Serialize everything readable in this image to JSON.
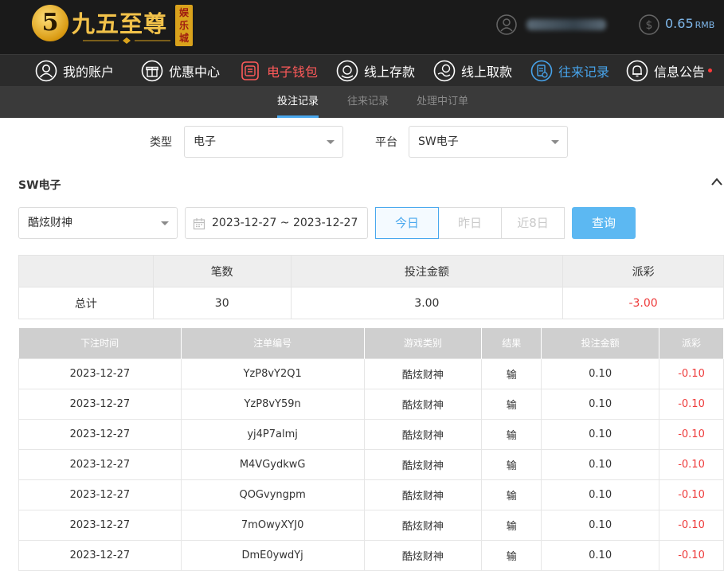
{
  "header": {
    "logo_char": "5",
    "logo_text": "九五至尊",
    "logo_seal": "娱乐城",
    "balance_value": "0.65",
    "balance_unit": "RMB"
  },
  "nav": {
    "items": [
      {
        "label": "我的账户",
        "icon": "user-icon"
      },
      {
        "label": "优惠中心",
        "icon": "gift-icon"
      },
      {
        "label": "电子钱包",
        "icon": "wallet-icon"
      },
      {
        "label": "线上存款",
        "icon": "deposit-icon"
      },
      {
        "label": "线上取款",
        "icon": "withdraw-icon"
      },
      {
        "label": "往来记录",
        "icon": "records-icon"
      },
      {
        "label": "信息公告",
        "icon": "bell-icon"
      }
    ],
    "active_color": "#47a3ea",
    "highlight_color": "#ff5a5a"
  },
  "subnav": {
    "items": [
      "投注记录",
      "往来记录",
      "处理中订单"
    ]
  },
  "filters": {
    "type_label": "类型",
    "type_value": "电子",
    "platform_label": "平台",
    "platform_value": "SW电子"
  },
  "section": {
    "title": "SW电子",
    "game_value": "酷炫财神",
    "date_range": "2023-12-27 ~ 2023-12-27",
    "day_buttons": [
      "今日",
      "昨日",
      "近8日"
    ],
    "query_label": "查询"
  },
  "summary": {
    "headers": [
      "",
      "笔数",
      "投注金额",
      "派彩"
    ],
    "total_label": "总计",
    "count": "30",
    "bet_amount": "3.00",
    "payout": "-3.00"
  },
  "records": {
    "headers": [
      "下注时间",
      "注单编号",
      "游戏类别",
      "结果",
      "投注金额",
      "派彩"
    ],
    "rows": [
      [
        "2023-12-27",
        "YzP8vY2Q1",
        "酷炫财神",
        "输",
        "0.10",
        "-0.10"
      ],
      [
        "2023-12-27",
        "YzP8vY59n",
        "酷炫财神",
        "输",
        "0.10",
        "-0.10"
      ],
      [
        "2023-12-27",
        "yj4P7almj",
        "酷炫财神",
        "输",
        "0.10",
        "-0.10"
      ],
      [
        "2023-12-27",
        "M4VGydkwG",
        "酷炫财神",
        "输",
        "0.10",
        "-0.10"
      ],
      [
        "2023-12-27",
        "QOGvyngpm",
        "酷炫财神",
        "输",
        "0.10",
        "-0.10"
      ],
      [
        "2023-12-27",
        "7mOwyXYJ0",
        "酷炫财神",
        "输",
        "0.10",
        "-0.10"
      ],
      [
        "2023-12-27",
        "DmE0ywdYj",
        "酷炫财神",
        "输",
        "0.10",
        "-0.10"
      ]
    ]
  }
}
